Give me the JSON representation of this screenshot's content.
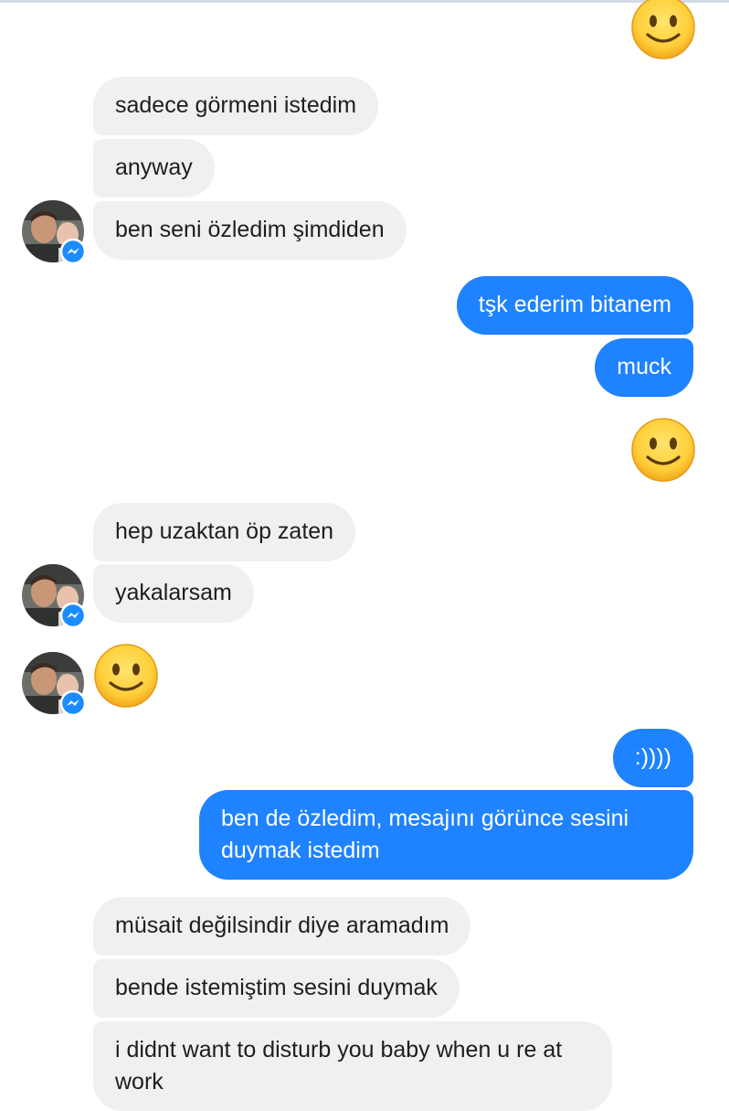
{
  "colors": {
    "incoming_bubble": "#f0f0f0",
    "outgoing_bubble": "#1f82ff",
    "messenger_badge": "#1a8cff"
  },
  "messages": [
    {
      "sender": "contact",
      "text": "sadece görmeni istedim"
    },
    {
      "sender": "contact",
      "text": "anyway"
    },
    {
      "sender": "contact",
      "text": "ben seni özledim şimdiden"
    },
    {
      "sender": "me",
      "text": "tşk ederim bitanem"
    },
    {
      "sender": "me",
      "text": "muck"
    },
    {
      "sender": "me",
      "type": "emoji",
      "icon": "slightly-smiling-face-emoji"
    },
    {
      "sender": "contact",
      "text": "hep uzaktan öp zaten"
    },
    {
      "sender": "contact",
      "text": "yakalarsam"
    },
    {
      "sender": "contact",
      "type": "emoji",
      "icon": "slightly-smiling-face-emoji"
    },
    {
      "sender": "me",
      "text": ":))))"
    },
    {
      "sender": "me",
      "text": "ben de özledim, mesajını görünce sesini duymak istedim"
    },
    {
      "sender": "contact",
      "text": "müsait değilsindir diye aramadım"
    },
    {
      "sender": "contact",
      "text": "bende istemiştim sesini duymak"
    },
    {
      "sender": "contact",
      "text": "i didnt want to disturb you baby when u re at work"
    }
  ],
  "icons": {
    "avatar": "contact-avatar",
    "badge": "messenger-badge-icon",
    "emoji": "slightly-smiling-face-emoji"
  }
}
